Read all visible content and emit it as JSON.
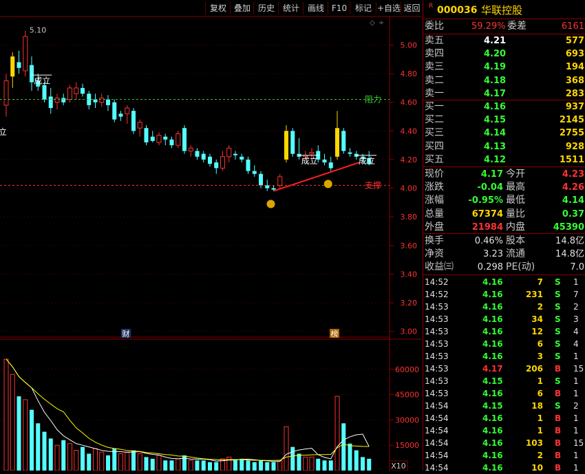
{
  "toolbar": {
    "buttons": [
      "复权",
      "叠加",
      "历史",
      "统计",
      "画线",
      "F10",
      "标记",
      "+自选",
      "返回"
    ]
  },
  "stock": {
    "badge": "R",
    "code": "000036",
    "name": "华联控股"
  },
  "colors": {
    "up": "#ff3232",
    "down": "#54ffff",
    "even": "#c8c8c8",
    "yellow": "#ffd700",
    "bg": "#000000",
    "border": "#8b0000"
  },
  "chart": {
    "price_axis": [
      "5.00",
      "4.80",
      "4.60",
      "4.40",
      "4.20",
      "4.00",
      "3.80",
      "3.60",
      "3.40",
      "3.20",
      "3.00"
    ],
    "volume_axis": [
      "60000",
      "45000",
      "30000",
      "15000"
    ],
    "volume_unit": "X10",
    "high_label": "5.10",
    "resistance_label": "阻力",
    "support_label": "支撑",
    "signal_labels": [
      "成立",
      "成立",
      "成立",
      "立"
    ],
    "markers": [
      "财",
      "榜"
    ]
  },
  "chart_data": {
    "type": "candlestick",
    "ylim": [
      2.96,
      5.18
    ],
    "resistance": 4.62,
    "support": 4.02,
    "candles": [
      {
        "o": 4.58,
        "h": 4.8,
        "l": 4.5,
        "c": 4.75
      },
      {
        "o": 4.78,
        "h": 4.95,
        "l": 4.7,
        "c": 4.92
      },
      {
        "o": 4.88,
        "h": 4.96,
        "l": 4.8,
        "c": 4.84
      },
      {
        "o": 4.82,
        "h": 5.1,
        "l": 4.78,
        "c": 5.06
      },
      {
        "o": 4.86,
        "h": 4.92,
        "l": 4.68,
        "c": 4.74
      },
      {
        "o": 4.75,
        "h": 4.8,
        "l": 4.68,
        "c": 4.71
      },
      {
        "o": 4.72,
        "h": 4.74,
        "l": 4.6,
        "c": 4.62
      },
      {
        "o": 4.64,
        "h": 4.7,
        "l": 4.52,
        "c": 4.56
      },
      {
        "o": 4.6,
        "h": 4.66,
        "l": 4.55,
        "c": 4.63
      },
      {
        "o": 4.63,
        "h": 4.66,
        "l": 4.58,
        "c": 4.6
      },
      {
        "o": 4.62,
        "h": 4.72,
        "l": 4.6,
        "c": 4.7
      },
      {
        "o": 4.66,
        "h": 4.74,
        "l": 4.62,
        "c": 4.7
      },
      {
        "o": 4.7,
        "h": 4.73,
        "l": 4.64,
        "c": 4.66
      },
      {
        "o": 4.66,
        "h": 4.68,
        "l": 4.55,
        "c": 4.58
      },
      {
        "o": 4.62,
        "h": 4.66,
        "l": 4.56,
        "c": 4.6
      },
      {
        "o": 4.6,
        "h": 4.66,
        "l": 4.57,
        "c": 4.63
      },
      {
        "o": 4.62,
        "h": 4.65,
        "l": 4.54,
        "c": 4.58
      },
      {
        "o": 4.6,
        "h": 4.62,
        "l": 4.46,
        "c": 4.48
      },
      {
        "o": 4.52,
        "h": 4.54,
        "l": 4.47,
        "c": 4.5
      },
      {
        "o": 4.52,
        "h": 4.58,
        "l": 4.45,
        "c": 4.56
      },
      {
        "o": 4.54,
        "h": 4.56,
        "l": 4.38,
        "c": 4.4
      },
      {
        "o": 4.42,
        "h": 4.48,
        "l": 4.36,
        "c": 4.46
      },
      {
        "o": 4.42,
        "h": 4.44,
        "l": 4.3,
        "c": 4.32
      },
      {
        "o": 4.36,
        "h": 4.4,
        "l": 4.32,
        "c": 4.33
      },
      {
        "o": 4.32,
        "h": 4.39,
        "l": 4.3,
        "c": 4.37
      },
      {
        "o": 4.36,
        "h": 4.38,
        "l": 4.3,
        "c": 4.34
      },
      {
        "o": 4.34,
        "h": 4.36,
        "l": 4.28,
        "c": 4.3
      },
      {
        "o": 4.3,
        "h": 4.4,
        "l": 4.28,
        "c": 4.38
      },
      {
        "o": 4.42,
        "h": 4.44,
        "l": 4.24,
        "c": 4.26
      },
      {
        "o": 4.26,
        "h": 4.3,
        "l": 4.22,
        "c": 4.28
      },
      {
        "o": 4.26,
        "h": 4.28,
        "l": 4.2,
        "c": 4.22
      },
      {
        "o": 4.24,
        "h": 4.26,
        "l": 4.18,
        "c": 4.2
      },
      {
        "o": 4.22,
        "h": 4.24,
        "l": 4.15,
        "c": 4.17
      },
      {
        "o": 4.18,
        "h": 4.2,
        "l": 4.1,
        "c": 4.14
      },
      {
        "o": 4.14,
        "h": 4.26,
        "l": 4.12,
        "c": 4.22
      },
      {
        "o": 4.22,
        "h": 4.3,
        "l": 4.18,
        "c": 4.28
      },
      {
        "o": 4.24,
        "h": 4.26,
        "l": 4.2,
        "c": 4.23
      },
      {
        "o": 4.22,
        "h": 4.24,
        "l": 4.18,
        "c": 4.2
      },
      {
        "o": 4.2,
        "h": 4.22,
        "l": 4.1,
        "c": 4.12
      },
      {
        "o": 4.12,
        "h": 4.16,
        "l": 4.08,
        "c": 4.1
      },
      {
        "o": 4.1,
        "h": 4.12,
        "l": 4.0,
        "c": 4.02
      },
      {
        "o": 4.02,
        "h": 4.06,
        "l": 3.98,
        "c": 4.0
      },
      {
        "o": 4.0,
        "h": 4.02,
        "l": 3.98,
        "c": 3.99
      },
      {
        "o": 4.02,
        "h": 4.1,
        "l": 3.99,
        "c": 4.08
      },
      {
        "o": 4.2,
        "h": 4.44,
        "l": 4.18,
        "c": 4.4
      },
      {
        "o": 4.4,
        "h": 4.42,
        "l": 4.22,
        "c": 4.24
      },
      {
        "o": 4.24,
        "h": 4.35,
        "l": 4.2,
        "c": 4.22
      },
      {
        "o": 4.22,
        "h": 4.26,
        "l": 4.2,
        "c": 4.23
      },
      {
        "o": 4.24,
        "h": 4.28,
        "l": 4.2,
        "c": 4.25
      },
      {
        "o": 4.26,
        "h": 4.3,
        "l": 4.18,
        "c": 4.2
      },
      {
        "o": 4.2,
        "h": 4.24,
        "l": 4.16,
        "c": 4.18
      },
      {
        "o": 4.18,
        "h": 4.22,
        "l": 4.12,
        "c": 4.14
      },
      {
        "o": 4.22,
        "h": 4.54,
        "l": 4.2,
        "c": 4.42
      },
      {
        "o": 4.4,
        "h": 4.42,
        "l": 4.24,
        "c": 4.26
      },
      {
        "o": 4.25,
        "h": 4.28,
        "l": 4.22,
        "c": 4.24
      },
      {
        "o": 4.24,
        "h": 4.26,
        "l": 4.2,
        "c": 4.22
      },
      {
        "o": 4.22,
        "h": 4.24,
        "l": 4.18,
        "c": 4.21
      },
      {
        "o": 4.21,
        "h": 4.26,
        "l": 4.16,
        "c": 4.17
      }
    ],
    "volume_ylim": [
      0,
      75000
    ],
    "volumes": [
      66000,
      57000,
      44000,
      42000,
      36000,
      28000,
      23000,
      19000,
      15000,
      18000,
      16000,
      12000,
      14000,
      10000,
      13000,
      11000,
      9000,
      13000,
      10000,
      11000,
      12000,
      10000,
      8000,
      7000,
      9000,
      6000,
      6000,
      7000,
      9000,
      6000,
      6000,
      6000,
      5000,
      5000,
      7000,
      8000,
      6000,
      7000,
      6000,
      5000,
      6000,
      5000,
      5000,
      6000,
      26000,
      14000,
      10000,
      8000,
      8000,
      7000,
      6000,
      6000,
      44000,
      28000,
      16000,
      12000,
      8000,
      7000
    ],
    "volume_colors": [
      "u",
      "u",
      "d",
      "u",
      "d",
      "d",
      "d",
      "d",
      "u",
      "d",
      "u",
      "u",
      "d",
      "d",
      "u",
      "u",
      "d",
      "d",
      "u",
      "u",
      "d",
      "u",
      "d",
      "d",
      "u",
      "d",
      "d",
      "u",
      "d",
      "u",
      "d",
      "d",
      "d",
      "d",
      "u",
      "u",
      "d",
      "d",
      "d",
      "d",
      "d",
      "d",
      "d",
      "u",
      "u",
      "d",
      "d",
      "u",
      "u",
      "d",
      "d",
      "d",
      "u",
      "d",
      "d",
      "d",
      "d",
      "d"
    ]
  },
  "quote": {
    "webi_label": "委比",
    "webi_value": "59.29%",
    "wecha_label": "委差",
    "wecha_value": "6161",
    "sells": [
      {
        "label": "卖五",
        "price": "4.21",
        "vol": "577"
      },
      {
        "label": "卖四",
        "price": "4.20",
        "vol": "693"
      },
      {
        "label": "卖三",
        "price": "4.19",
        "vol": "194"
      },
      {
        "label": "卖二",
        "price": "4.18",
        "vol": "368"
      },
      {
        "label": "卖一",
        "price": "4.17",
        "vol": "283"
      }
    ],
    "buys": [
      {
        "label": "买一",
        "price": "4.16",
        "vol": "937"
      },
      {
        "label": "买二",
        "price": "4.15",
        "vol": "2145"
      },
      {
        "label": "买三",
        "price": "4.14",
        "vol": "2755"
      },
      {
        "label": "买四",
        "price": "4.13",
        "vol": "928"
      },
      {
        "label": "买五",
        "price": "4.12",
        "vol": "1511"
      }
    ],
    "stats": [
      {
        "l1": "现价",
        "v1": "4.17",
        "l2": "今开",
        "v2": "4.23",
        "c1": "d",
        "c2": "u"
      },
      {
        "l1": "涨跌",
        "v1": "-0.04",
        "l2": "最高",
        "v2": "4.26",
        "c1": "d",
        "c2": "u"
      },
      {
        "l1": "涨幅",
        "v1": "-0.95%",
        "l2": "最低",
        "v2": "4.14",
        "c1": "d",
        "c2": "d"
      },
      {
        "l1": "总量",
        "v1": "67374",
        "l2": "量比",
        "v2": "0.37",
        "c1": "y",
        "c2": "d"
      },
      {
        "l1": "外盘",
        "v1": "21984",
        "l2": "内盘",
        "v2": "45390",
        "c1": "u",
        "c2": "d"
      }
    ],
    "fin": [
      {
        "l1": "换手",
        "v1": "0.46%",
        "l2": "股本",
        "v2": "14.8亿"
      },
      {
        "l1": "净资",
        "v1": "3.23",
        "l2": "流通",
        "v2": "14.8亿"
      },
      {
        "l1": "收益㈢",
        "v1": "0.298",
        "l2": "PE(动)",
        "v2": "7.0"
      }
    ]
  },
  "ticks": [
    {
      "t": "14:52",
      "p": "4.16",
      "v": "7",
      "s": "S",
      "n": "1"
    },
    {
      "t": "14:52",
      "p": "4.16",
      "v": "231",
      "s": "S",
      "n": "7"
    },
    {
      "t": "14:53",
      "p": "4.16",
      "v": "2",
      "s": "S",
      "n": "2"
    },
    {
      "t": "14:53",
      "p": "4.16",
      "v": "34",
      "s": "S",
      "n": "3"
    },
    {
      "t": "14:53",
      "p": "4.16",
      "v": "12",
      "s": "S",
      "n": "4"
    },
    {
      "t": "14:53",
      "p": "4.16",
      "v": "6",
      "s": "S",
      "n": "4"
    },
    {
      "t": "14:53",
      "p": "4.16",
      "v": "3",
      "s": "S",
      "n": "1"
    },
    {
      "t": "14:53",
      "p": "4.17",
      "v": "206",
      "s": "B",
      "n": "15"
    },
    {
      "t": "14:53",
      "p": "4.15",
      "v": "1",
      "s": "S",
      "n": "1"
    },
    {
      "t": "14:53",
      "p": "4.16",
      "v": "6",
      "s": "B",
      "n": "1"
    },
    {
      "t": "14:54",
      "p": "4.15",
      "v": "18",
      "s": "S",
      "n": "2"
    },
    {
      "t": "14:54",
      "p": "4.16",
      "v": "1",
      "s": "B",
      "n": "1"
    },
    {
      "t": "14:54",
      "p": "4.16",
      "v": "1",
      "s": "B",
      "n": "1"
    },
    {
      "t": "14:54",
      "p": "4.16",
      "v": "103",
      "s": "B",
      "n": "15"
    },
    {
      "t": "14:54",
      "p": "4.16",
      "v": "2",
      "s": "B",
      "n": "1"
    },
    {
      "t": "14:54",
      "p": "4.16",
      "v": "10",
      "s": "B",
      "n": "1"
    }
  ]
}
